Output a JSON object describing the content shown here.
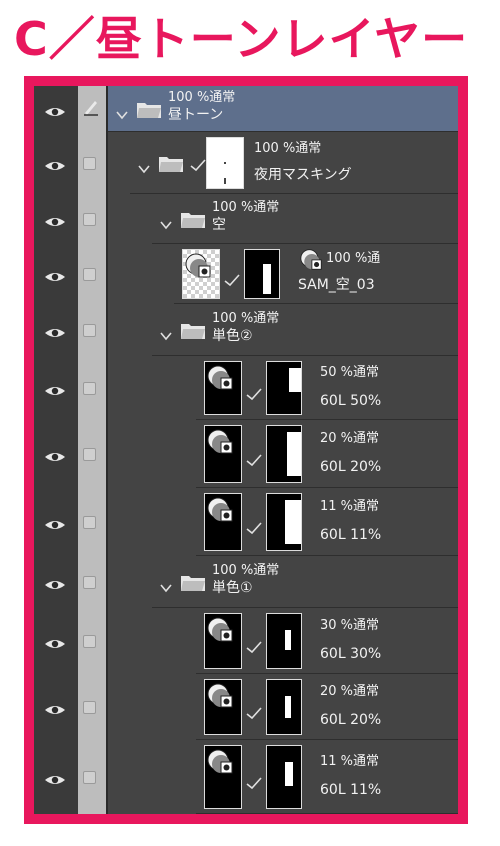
{
  "heading": "C／昼トーンレイヤー",
  "colors": {
    "accent": "#e8175d",
    "panel_bg": "#444444",
    "selected_row": "#5e6f8c",
    "lock_column": "#bdbdbd"
  },
  "layers": [
    {
      "kind": "folder",
      "opacity": "100 %通常",
      "name": "昼トーン",
      "selected": true,
      "icons": [
        "eye-icon",
        "pen-icon",
        "chevron-down-icon",
        "folder-icon"
      ]
    },
    {
      "kind": "folder",
      "opacity": "100 %通常",
      "name": "夜用マスキング",
      "has_mask": true,
      "icons": [
        "eye-icon",
        "chevron-down-icon",
        "folder-icon",
        "checkmark-icon"
      ]
    },
    {
      "kind": "folder",
      "opacity": "100 %通常",
      "name": "空"
    },
    {
      "kind": "layer",
      "opacity": "100 %通",
      "name": "SAM_空_03"
    },
    {
      "kind": "folder",
      "opacity": "100 %通常",
      "name": "単色②"
    },
    {
      "kind": "layer",
      "opacity": "50 %通常",
      "name": "60L 50%"
    },
    {
      "kind": "layer",
      "opacity": "20 %通常",
      "name": "60L 20%"
    },
    {
      "kind": "layer",
      "opacity": "11 %通常",
      "name": "60L 11%"
    },
    {
      "kind": "folder",
      "opacity": "100 %通常",
      "name": "単色①"
    },
    {
      "kind": "layer",
      "opacity": "30 %通常",
      "name": "60L 30%"
    },
    {
      "kind": "layer",
      "opacity": "20 %通常",
      "name": "60L 20%"
    },
    {
      "kind": "layer",
      "opacity": "11 %通常",
      "name": "60L 11%"
    }
  ]
}
